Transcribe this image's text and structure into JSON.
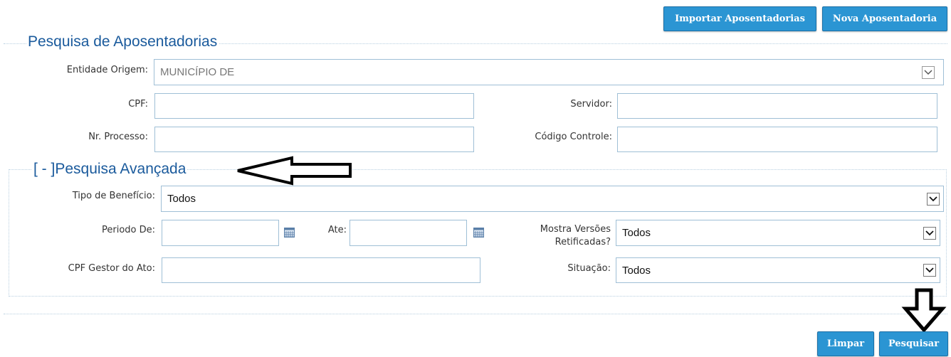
{
  "toolbar": {
    "import_label": "Importar Aposentadorias",
    "new_label": "Nova Aposentadoria"
  },
  "search": {
    "title": "Pesquisa de Aposentadorias",
    "entidade_label": "Entidade Origem:",
    "entidade_value": "MUNICÍPIO DE",
    "cpf_label": "CPF:",
    "cpf_value": "",
    "servidor_label": "Servidor:",
    "servidor_value": "",
    "processo_label": "Nr. Processo:",
    "processo_value": "",
    "codigo_label": "Código Controle:",
    "codigo_value": ""
  },
  "advanced": {
    "toggle_label": "[ - ]Pesquisa Avançada",
    "tipo_label": "Tipo de Benefício:",
    "tipo_value": "Todos",
    "periodo_label": "Periodo De:",
    "periodo_value": "",
    "ate_label": "Ate:",
    "ate_value": "",
    "mostra_label_1": "Mostra Versões",
    "mostra_label_2": "Retificadas?",
    "mostra_value": "Todos",
    "gestor_label": "CPF Gestor do Ato:",
    "gestor_value": "",
    "situacao_label": "Situação:",
    "situacao_value": "Todos"
  },
  "actions": {
    "clear_label": "Limpar",
    "search_label": "Pesquisar"
  },
  "colors": {
    "button": "#2b95d3",
    "title": "#1a5a9c",
    "border": "#9fbfd6"
  },
  "icons": [
    "chevron-down-icon",
    "calendar-icon",
    "left-arrow-annotation",
    "down-arrow-annotation"
  ]
}
